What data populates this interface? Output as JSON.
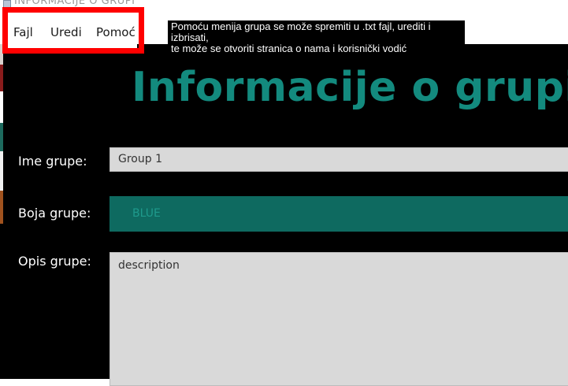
{
  "window": {
    "title": "INFORMACIJE O GRUPI"
  },
  "menu": {
    "items": [
      {
        "label": "Fajl"
      },
      {
        "label": "Uredi"
      },
      {
        "label": "Pomoć"
      }
    ]
  },
  "note": {
    "line1": "Pomoću menija grupa se može spremiti u .txt fajl, urediti i izbrisati,",
    "line2": "te može se otvoriti stranica o nama i korisnički vodić"
  },
  "form": {
    "heading": "Informacije o grupi",
    "name_label": "Ime grupe:",
    "name_value": "Group 1",
    "color_label": "Boja grupe:",
    "color_value": "BLUE",
    "description_label": "Opis grupe:",
    "description_value": "description"
  },
  "colors": {
    "accent": "#138a7e",
    "color_field": "#0e6a60",
    "highlight": "#ff0000",
    "background": "#000000"
  }
}
